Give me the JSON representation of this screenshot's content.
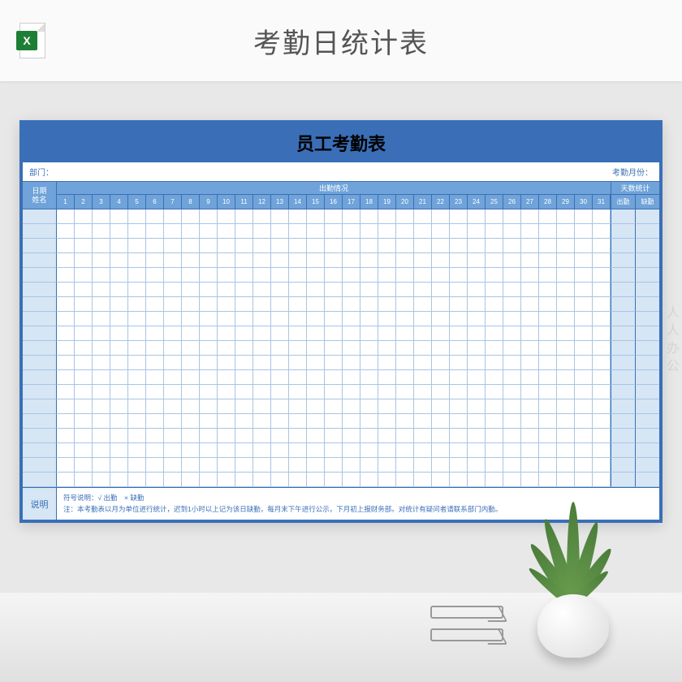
{
  "header": {
    "page_title": "考勤日统计表",
    "excel_badge": "X"
  },
  "sheet": {
    "title": "员工考勤表",
    "meta": {
      "department_label": "部门：",
      "month_label": "考勤月份："
    },
    "corner": {
      "top": "日期",
      "bottom": "姓名"
    },
    "attendance_label": "出勤情况",
    "stats_label": "天数统计",
    "stats_sub": {
      "present": "出勤",
      "absent": "缺勤"
    },
    "days": [
      "1",
      "2",
      "3",
      "4",
      "5",
      "6",
      "7",
      "8",
      "9",
      "10",
      "11",
      "12",
      "13",
      "14",
      "15",
      "16",
      "17",
      "18",
      "19",
      "20",
      "21",
      "22",
      "23",
      "24",
      "25",
      "26",
      "27",
      "28",
      "29",
      "30",
      "31"
    ],
    "data_row_count": 19,
    "notes": {
      "label": "说明",
      "line1": "符号说明：√ 出勤　× 缺勤",
      "line2": "注：本考勤表以月为单位进行统计，迟到1小时以上记为该日缺勤，每月末下午进行公示，下月初上报财务部。对统计有疑问者请联系部门内勤。"
    }
  },
  "watermark": "人人办公"
}
